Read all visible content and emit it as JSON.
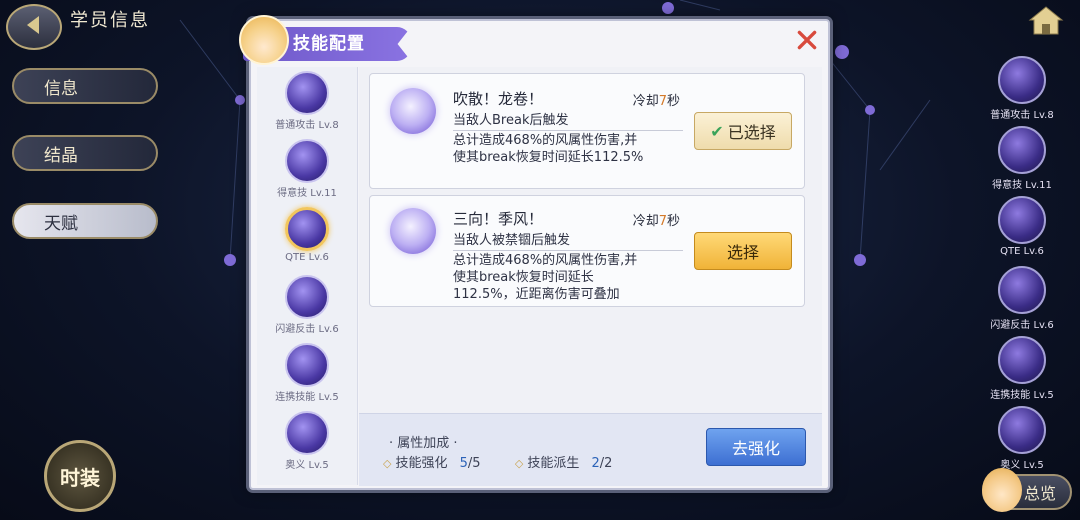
{
  "header": {
    "title": "学员信息"
  },
  "left_menu": {
    "items": [
      {
        "label": "信息"
      },
      {
        "label": "结晶"
      },
      {
        "label": "天赋"
      }
    ],
    "costume_label": "时装"
  },
  "right_skills": [
    {
      "label": "普通攻击 Lv.8"
    },
    {
      "label": "得意技 Lv.11"
    },
    {
      "label": "QTE Lv.6"
    },
    {
      "label": "闪避反击 Lv.6"
    },
    {
      "label": "连携技能 Lv.5"
    },
    {
      "label": "奥义 Lv.5"
    }
  ],
  "overview_label": "总览",
  "dialog": {
    "title": "技能配置",
    "skill_list": [
      {
        "label": "普通攻击 Lv.8"
      },
      {
        "label": "得意技 Lv.11"
      },
      {
        "label": "QTE Lv.6"
      },
      {
        "label": "闪避反击 Lv.6"
      },
      {
        "label": "连携技能 Lv.5"
      },
      {
        "label": "奥义 Lv.5"
      }
    ],
    "cards": [
      {
        "name": "吹散！龙卷！",
        "cd_prefix": "冷却",
        "cd_value": "7",
        "cd_suffix": "秒",
        "desc_first": "当敌人Break后触发",
        "desc_rest": "总计造成468%的风属性伤害,并\n使其break恢复时间延长112.5%",
        "button_label": "已选择",
        "button_check": "✔"
      },
      {
        "name": "三向！季风！",
        "cd_prefix": "冷却",
        "cd_value": "7",
        "cd_suffix": "秒",
        "desc_first": "当敌人被禁锢后触发",
        "desc_rest": "总计造成468%的风属性伤害,并\n使其break恢复时间延长\n112.5%，近距离伤害可叠加",
        "button_label": "选择"
      }
    ],
    "attributes": {
      "title": "· 属性加成 ·",
      "items": [
        {
          "label": "技能强化",
          "current": "5",
          "total": "/5"
        },
        {
          "label": "技能派生",
          "current": "2",
          "total": "/2"
        }
      ]
    },
    "enhance_label": "去强化"
  }
}
